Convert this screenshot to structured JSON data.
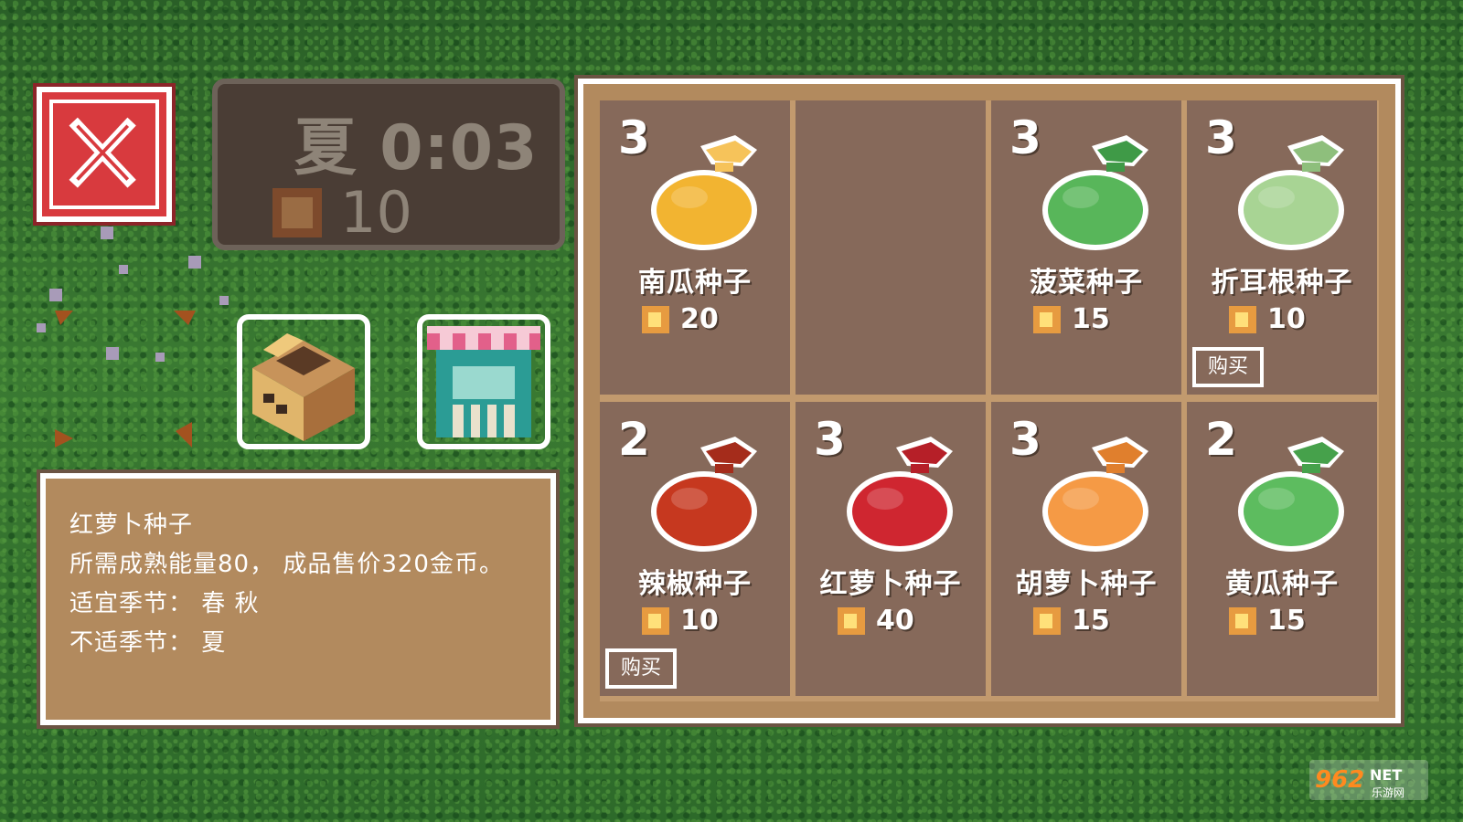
{
  "status": {
    "season_time": "夏 0:03",
    "coins": "10"
  },
  "description": {
    "lines": [
      "红萝卜种子",
      "所需成熟能量80， 成品售价320金币。",
      "适宜季节：  春  秋",
      "不适季节：  夏"
    ]
  },
  "shop": {
    "items": [
      {
        "qty": "3",
        "name": "南瓜种子",
        "price": "20",
        "color": "#f2b431",
        "tie": "#f6c35a"
      },
      null,
      {
        "qty": "3",
        "name": "菠菜种子",
        "price": "15",
        "color": "#58b65a",
        "tie": "#3f9a47"
      },
      {
        "qty": "3",
        "name": "折耳根种子",
        "price": "10",
        "color": "#a8d494",
        "tie": "#8ebf7c",
        "buy": "购买"
      },
      {
        "qty": "2",
        "name": "辣椒种子",
        "price": "10",
        "color": "#c6381f",
        "tie": "#a52c1b",
        "buy": "购买"
      },
      {
        "qty": "3",
        "name": "红萝卜种子",
        "price": "40",
        "color": "#cf2630",
        "tie": "#b61f28"
      },
      {
        "qty": "3",
        "name": "胡萝卜种子",
        "price": "15",
        "color": "#f59a45",
        "tie": "#e07f2d"
      },
      {
        "qty": "2",
        "name": "黄瓜种子",
        "price": "15",
        "color": "#5dbc5f",
        "tie": "#46a14b"
      }
    ]
  },
  "watermark": {
    "text": "962NET",
    "sub": "乐游网"
  }
}
